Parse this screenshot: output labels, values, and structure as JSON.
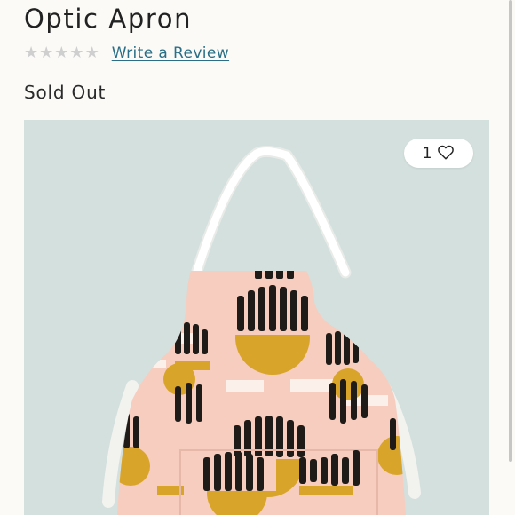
{
  "product": {
    "title": "Optic Apron",
    "review_link": "Write a Review",
    "status": "Sold Out",
    "rating": {
      "stars_filled": 0,
      "stars_total": 5
    }
  },
  "image": {
    "alt": "Optic Apron",
    "like_count": "1",
    "like_icon": "heart-outline-icon"
  },
  "colors": {
    "link": "#2a6f87",
    "background": "#d6e2df",
    "fabric": "#f6cdbf",
    "print_black": "#1e1b19",
    "print_mustard": "#d8a52a"
  }
}
